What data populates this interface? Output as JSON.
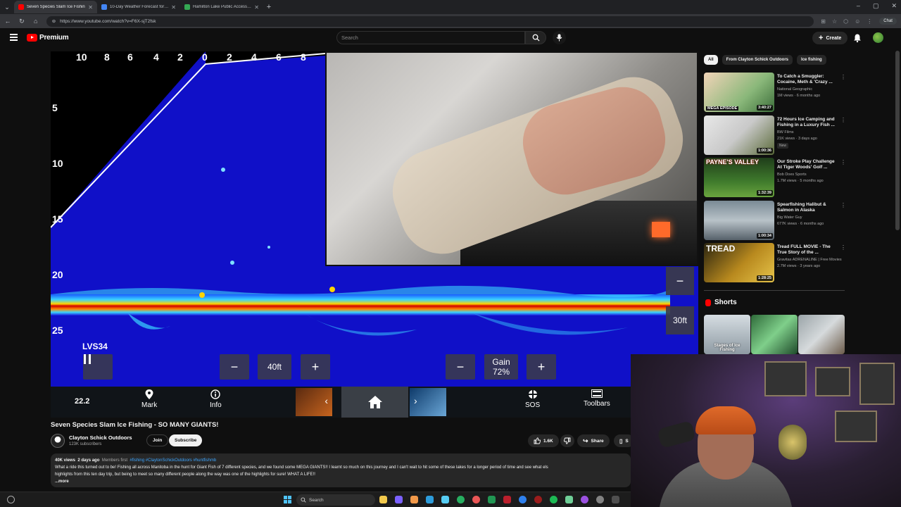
{
  "browser": {
    "tabs": [
      {
        "label": "Seven Species Slam Ice Fishin",
        "active": true,
        "color": "#ff0000"
      },
      {
        "label": "10-Day Weather Forecast for Fort",
        "active": false,
        "color": "#4285f4"
      },
      {
        "label": "Hamilton Lake Public Access Site",
        "active": false,
        "color": "#34a853"
      }
    ],
    "url": "https://www.youtube.com/watch?v=F6X-sjT2fsk",
    "chat_label": "Chat"
  },
  "masthead": {
    "logo_text": "Premium",
    "search_placeholder": "Search",
    "create_label": "Create"
  },
  "player": {
    "range_ticks": [
      "10",
      "8",
      "6",
      "4",
      "2",
      "0",
      "2",
      "4",
      "6",
      "8"
    ],
    "depth_ticks": [
      "5",
      "10",
      "15",
      "20",
      "25"
    ],
    "mode_label": "LVS34",
    "range_value": "40ft",
    "gain_label": "Gain",
    "gain_value": "72%",
    "side_range": "30ft",
    "toolbar": {
      "temp": "22.2",
      "mark": "Mark",
      "info": "Info",
      "sos": "SOS",
      "toolbars": "Toolbars"
    },
    "colors": {
      "water": "#1010c8",
      "band_hot": "#d10000",
      "band_warm": "#ffd400"
    }
  },
  "video": {
    "title": "Seven Species Slam Ice Fishing - SO MANY GIANTS!",
    "channel": "Clayton Schick Outdoors",
    "subscribers": "123K subscribers",
    "join_label": "Join",
    "subscribe_label": "Subscribe",
    "likes": "1.6K",
    "share_label": "Share",
    "save_label": "S",
    "views": "40K views",
    "age": "2 days ago",
    "members_first": "Members first",
    "hashtags": "#fishing #ClaytonSchickOutdoors #huntfishmb",
    "description_line1": "What a ride this turned out to be! Fishing all across Manitoba in the hunt for Giant Fish of 7 different species, and we found some MEGA GIANTS!! I learnt so much on this journey and I can't wait to hit some of these lakes for a longer period of time and see what els",
    "description_line2": "highlights from this ten day trip, but being to meet so many different people along the way was one of the highlights for sure! WHAT A LIFE!!",
    "more_label": "...more"
  },
  "sidebar": {
    "chips": [
      "All",
      "From Clayton Schick Outdoors",
      "Ice fishing"
    ],
    "recommendations": [
      {
        "title": "To Catch a Smuggler: Cocaine, Meth & 'Crazy ...",
        "channel": "National Geographic",
        "meta": "1M views · 6 months ago",
        "duration": "3:40:27",
        "badge": "",
        "thumb_text": "MEGA EPISODE"
      },
      {
        "title": "72 Hours Ice Camping and Fishing in a Luxury Fish ...",
        "channel": "BW Films",
        "meta": "21K views · 3 days ago",
        "duration": "1:00:36",
        "badge": "New",
        "thumb_text": ""
      },
      {
        "title": "Our Stroke Play Challenge At Tiger Woods' Golf ...",
        "channel": "Bob Does Sports",
        "meta": "1.7M views · 5 months ago",
        "duration": "1:32:39",
        "badge": "",
        "thumb_text": "PAYNE'S VALLEY"
      },
      {
        "title": "Spearfishing Halibut & Salmon in Alaska",
        "channel": "Big Water Guy",
        "meta": "677K views · 6 months ago",
        "duration": "1:00:34",
        "badge": "",
        "thumb_text": ""
      },
      {
        "title": "Tread FULL MOVIE - The True Story of the ...",
        "channel": "Gravitas ADRENALINE | Free Movies",
        "meta": "2.7M views · 3 years ago",
        "duration": "1:28:25",
        "badge": "",
        "thumb_text": "TREAD"
      }
    ],
    "shorts_label": "Shorts",
    "shorts": [
      {
        "caption": "Stages of Ice Fishing"
      },
      {
        "caption": ""
      },
      {
        "caption": ""
      }
    ]
  },
  "taskbar": {
    "search_label": "Search"
  }
}
